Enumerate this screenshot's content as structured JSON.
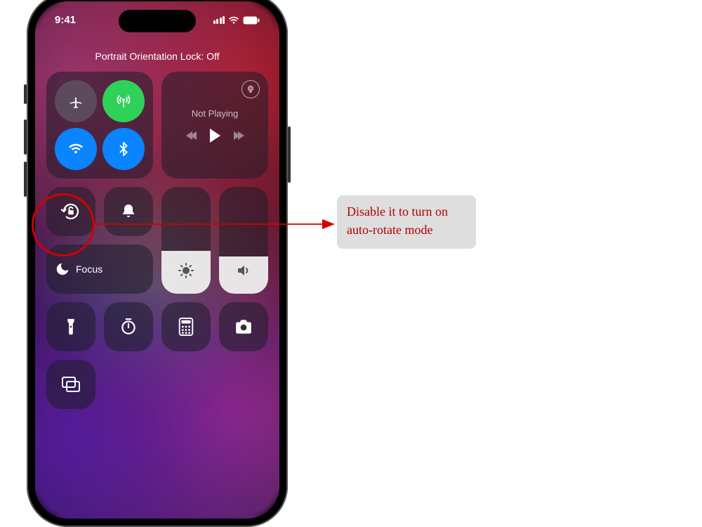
{
  "status_bar": {
    "time": "9:41"
  },
  "control_center": {
    "status_text": "Portrait Orientation Lock: Off",
    "media": {
      "now_playing": "Not Playing"
    },
    "focus": {
      "label": "Focus"
    },
    "brightness": {
      "level": 0.4
    },
    "volume": {
      "level": 0.35
    }
  },
  "annotation": {
    "text": "Disable it to turn on auto-rotate mode"
  },
  "colors": {
    "highlight": "#d00000",
    "annotation_bg": "#dedede",
    "annotation_text": "#b00000"
  }
}
